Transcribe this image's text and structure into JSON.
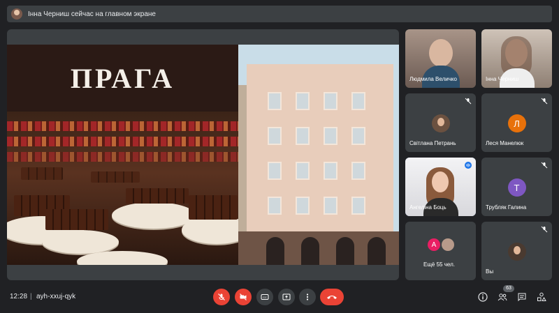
{
  "topbar": {
    "presenter_text": "Інна Черниш сейчас на главном экране"
  },
  "slide": {
    "title": "ПРАГА"
  },
  "participants": [
    {
      "name": "Людмила Величко",
      "type": "video",
      "muted": false
    },
    {
      "name": "Інна Черниш",
      "type": "video",
      "muted": false
    },
    {
      "name": "Світлана Петрань",
      "type": "photo",
      "muted": true
    },
    {
      "name": "Леся Манелюк",
      "type": "initial",
      "initial": "Л",
      "color": "#e8710a",
      "muted": true
    },
    {
      "name": "Ангеліна Боць",
      "type": "video",
      "muted": false,
      "speaking": true
    },
    {
      "name": "Трубляк Галина",
      "type": "initial",
      "initial": "Т",
      "color": "#7e57c2",
      "muted": true
    },
    {
      "name": "Ещё 55 чел.",
      "type": "more",
      "initial": "А",
      "color": "#e91e63",
      "muted": false
    },
    {
      "name": "Вы",
      "type": "photo",
      "muted": true
    }
  ],
  "bottombar": {
    "time": "12:28",
    "separator": "|",
    "meeting_code": "ayh-xxuj-qyk",
    "participant_count": "63"
  },
  "colors": {
    "background": "#202124",
    "tile": "#3c4043",
    "danger": "#ea4335",
    "speaking": "#8ab4f8"
  }
}
